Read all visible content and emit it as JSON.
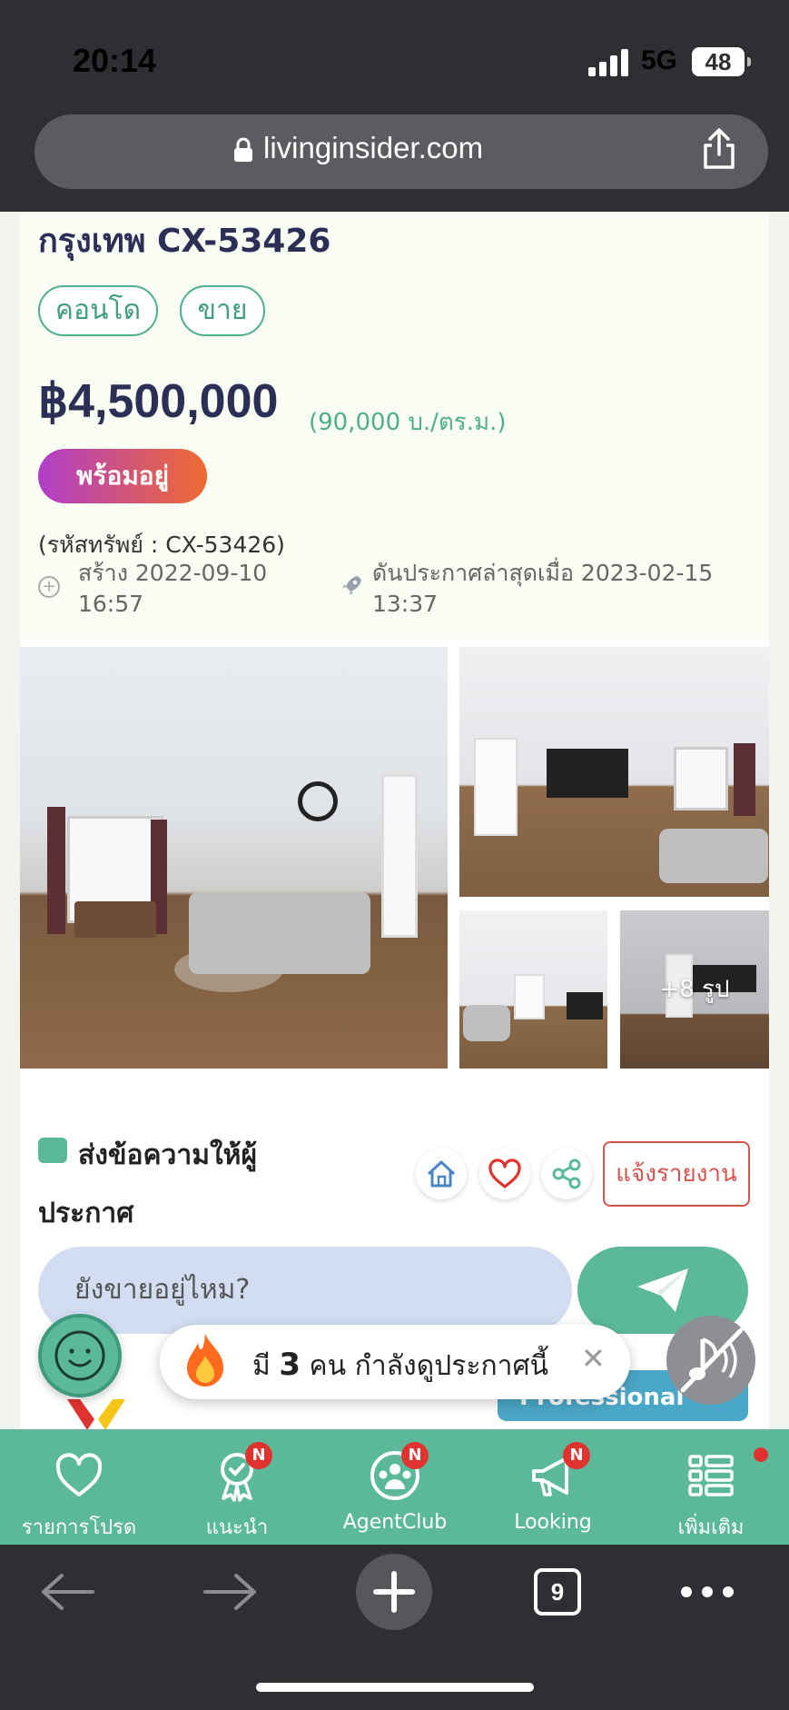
{
  "status_bar": {
    "time": "20:14",
    "network": "5G",
    "battery": "48"
  },
  "browser": {
    "url": "livinginsider.com",
    "tab_count": "9"
  },
  "listing": {
    "title": "กรุงเทพ CX-53426",
    "tags": [
      "คอนโด",
      "ขาย"
    ],
    "price": "฿4,500,000",
    "price_per_sqm": "(90,000 บ./ตร.ม.)",
    "status": "พร้อมอยู่",
    "code": "(รหัสทรัพย์ : CX-53426)",
    "created": "สร้าง 2022-09-10 16:57",
    "bumped": "ดันประกาศล่าสุดเมื่อ 2023-02-15 13:37",
    "more_photos": "+8 รูป"
  },
  "message": {
    "title": "ส่งข้อความให้ผู้ประกาศ",
    "report_label": "แจ้งรายงาน",
    "input_placeholder": "ยังขายอยู่ไหม?"
  },
  "viewers": {
    "prefix": "มี",
    "count": "3",
    "suffix": "คน กำลังดูประกาศนี้"
  },
  "promo": {
    "badge": "Professional"
  },
  "bottom_nav": [
    {
      "label": "รายการโปรด",
      "badge": ""
    },
    {
      "label": "แนะนำ",
      "badge": "N"
    },
    {
      "label": "AgentClub",
      "badge": "N"
    },
    {
      "label": "Looking",
      "badge": "N"
    },
    {
      "label": "เพิ่มเติม",
      "badge": ""
    }
  ],
  "colors": {
    "brand_green": "#5bb99a",
    "title_navy": "#2b2f55",
    "alert_red": "#e0332f"
  }
}
